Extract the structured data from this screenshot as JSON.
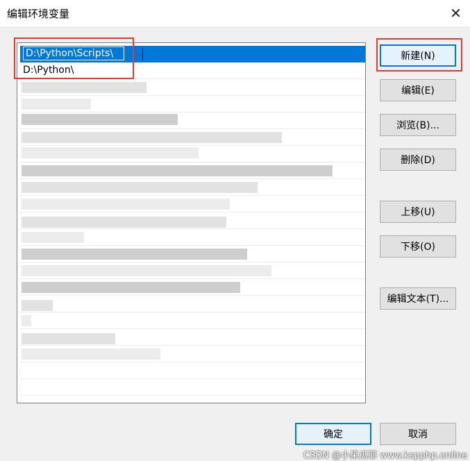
{
  "window": {
    "title": "编辑环境变量",
    "close_icon": "close-icon"
  },
  "list": {
    "items": [
      {
        "value": "D:\\Python\\Scripts\\",
        "selected": true,
        "editing": true
      },
      {
        "value": "D:\\Python\\",
        "selected": false,
        "editing": false
      }
    ]
  },
  "buttons": {
    "new": "新建(N)",
    "edit": "编辑(E)",
    "browse": "浏览(B)...",
    "delete": "删除(D)",
    "move_up": "上移(U)",
    "move_down": "下移(O)",
    "edit_text": "编辑文本(T)...",
    "ok": "确定",
    "cancel": "取消"
  },
  "colors": {
    "selection": "#0078d7",
    "highlight_box": "#e53935"
  },
  "watermark": "CSDN @小呆瓜耶  www.kspphp.online"
}
